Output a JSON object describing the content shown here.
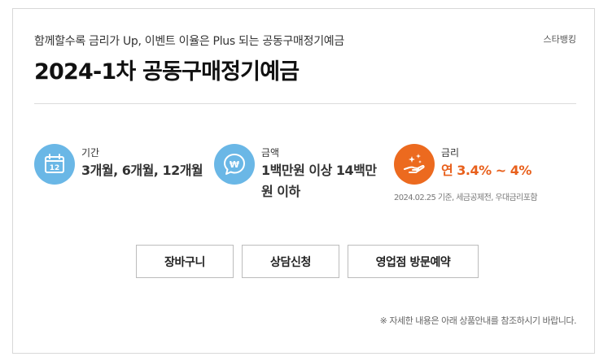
{
  "header": {
    "subtitle": "함께할수록 금리가 Up, 이벤트 이율은 Plus 되는 공동구매정기예금",
    "channel": "스타뱅킹",
    "title": "2024-1차 공동구매정기예금"
  },
  "info": [
    {
      "label": "기간",
      "value": "3개월, 6개월, 12개월",
      "icon": "calendar-icon"
    },
    {
      "label": "금액",
      "value": "1백만원 이상 14백만원 이하",
      "icon": "won-speech-bubble-icon"
    },
    {
      "label": "금리",
      "value": "연 3.4% ~ 4%",
      "note": "2024.02.25 기준, 세금공제전, 우대금리포함",
      "icon": "hand-sparkle-icon"
    }
  ],
  "calendar_day": "12",
  "won_symbol": "₩",
  "buttons": {
    "cart": "장바구니",
    "consult": "상담신청",
    "branch_visit": "영업점 방문예약"
  },
  "footnote": "※ 자세한 내용은 아래 상품안내를 참조하시기 바랍니다.",
  "colors": {
    "blue_icon": "#6ab7e6",
    "orange_icon": "#ec6a1f",
    "rate_text": "#e8601c"
  }
}
